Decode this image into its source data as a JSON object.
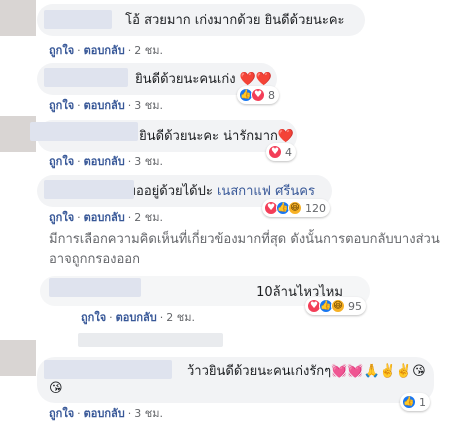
{
  "comments": [
    {
      "text": "โอ้ สวยมาก เก่งมากด้วย ยินดีด้วยนะคะ",
      "time": "2 ชม.",
      "count": ""
    },
    {
      "text": "ยินดีด้วยนะคนเก่ง ❤️❤️",
      "time": "3 ชม.",
      "count": "8"
    },
    {
      "text": "ยินดีด้วยนะคะ น่ารักมาก❤️",
      "time": "3 ชม.",
      "count": "4"
    },
    {
      "text": "ขออยู่ด้วยได้ปะ",
      "mention": "เนสกาแฟ ศรีนคร",
      "time": "2 ชม.",
      "count": "120"
    },
    {
      "text": "10ล้านไหวไหม",
      "time": "2 ชม.",
      "count": "95"
    },
    {
      "text": "ว้าวยินดีด้วยนะคนเก่งรักๆ💓💓🙏✌️✌️😘",
      "text2": "😘",
      "time": "3 ชม.",
      "count": "1"
    }
  ],
  "actions": {
    "like": "ถูกใจ",
    "reply": "ตอบกลับ",
    "sep": "·"
  },
  "notice": "มีการเลือกความคิดเห็นที่เกี่ยวข้องมากที่สุด ดังนั้นการตอบกลับบางส่วนอาจถูกกรองออก",
  "colors": {
    "link": "#385898",
    "bubble": "#f2f3f5",
    "like": "#1877f2",
    "love": "#f33e58",
    "haha": "#f7b125"
  }
}
